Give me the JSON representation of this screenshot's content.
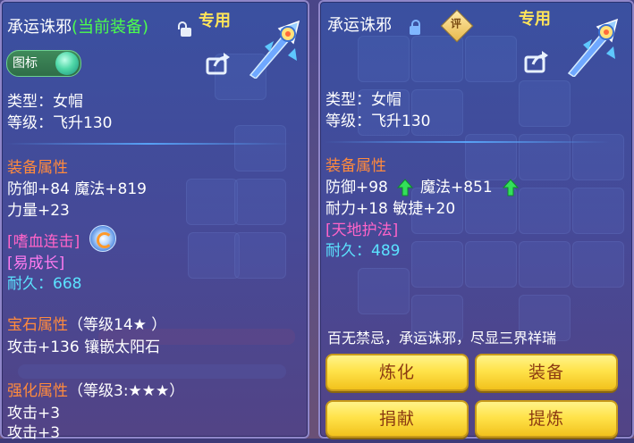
{
  "left_panel": {
    "item_name": "承运诛邪",
    "equipped_tag": "(当前装备)",
    "exclusive_tag": "专用",
    "icon_toggle_label": "图标",
    "type_line": "类型：女帽",
    "level_line": "等级：飞升130",
    "equip_attr_heading": "装备属性",
    "attr_line1": "防御+84 魔法+819",
    "attr_line2": "力量+23",
    "special_skill": "[嗜血连击]",
    "special_effect": "[易成长]",
    "durability_label": "耐久：",
    "durability_value": "668",
    "gem_heading": "宝石属性",
    "gem_level": "（等级14★ ）",
    "gem_line": "攻击+136 镶嵌太阳石",
    "forge_heading": "强化属性",
    "forge_level": "（等级3:★★★）",
    "forge_line1": "攻击+3",
    "forge_line2": "攻击+3"
  },
  "right_panel": {
    "item_name": "承运诛邪",
    "eval_badge": "评",
    "exclusive_tag": "专用",
    "type_line": "类型：女帽",
    "level_line": "等级：飞升130",
    "equip_attr_heading": "装备属性",
    "attr_defense": "防御+98",
    "attr_magic": "魔法+851",
    "attr_line2": "耐力+18 敏捷+20",
    "special_skill": "[天地护法]",
    "durability_label": "耐久：",
    "durability_value": "489",
    "description": "百无禁忌，承运诛邪，尽显三界祥瑞",
    "buttons": {
      "refine": "炼化",
      "equip": "装备",
      "donate": "捐献",
      "extract": "提炼"
    }
  },
  "colors": {
    "panel_border": "#8f86c9",
    "title_green": "#4cff4c",
    "tag_yellow": "#ffe45a",
    "heading_orange": "#ff8a3d",
    "skill_pink": "#ff64c8",
    "value_cyan": "#5be3ff",
    "button_gold": "#ffe34a",
    "button_text": "#8b3a12"
  },
  "icons": [
    "lock-open-icon",
    "lock-icon",
    "weapon-icon",
    "share-icon",
    "up-arrow-icon",
    "skill-icon",
    "toggle-knob-icon",
    "eval-badge-icon"
  ]
}
